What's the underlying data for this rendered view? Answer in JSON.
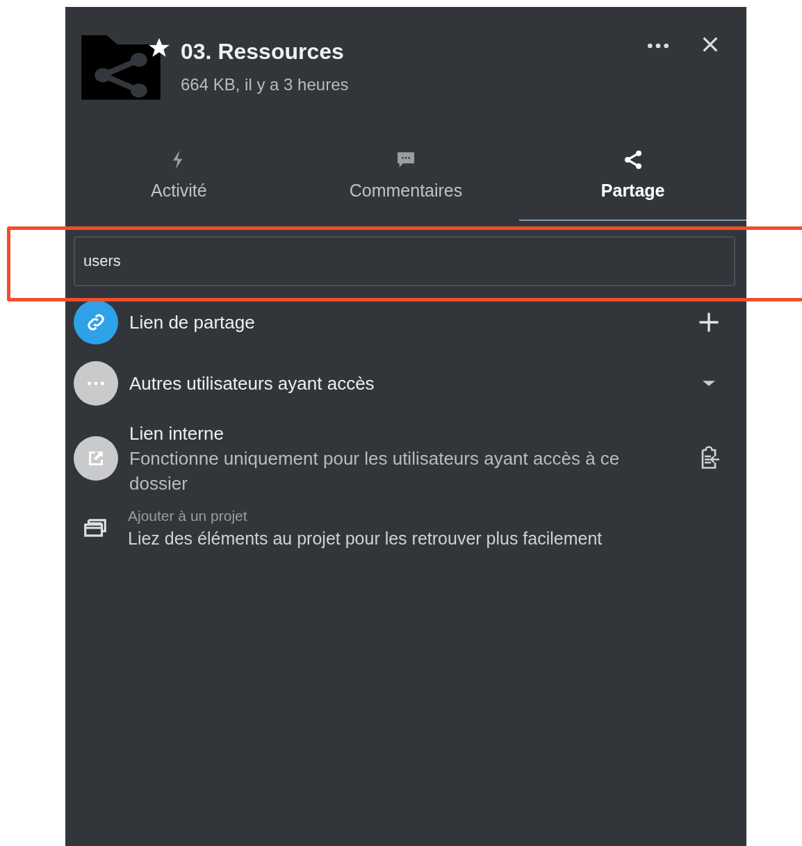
{
  "header": {
    "title": "03. Ressources",
    "subtitle": "664 KB, il y a 3 heures",
    "favorite": true
  },
  "tabs": [
    {
      "label": "Activité",
      "kind": "activity",
      "selected": false
    },
    {
      "label": "Commentaires",
      "kind": "comments",
      "selected": false
    },
    {
      "label": "Partage",
      "kind": "sharing",
      "selected": true
    }
  ],
  "search": {
    "value": "users",
    "highlighted": true
  },
  "entries": [
    {
      "kind": "share-link",
      "title": "Lien de partage",
      "action": {
        "kind": "add"
      }
    },
    {
      "kind": "others",
      "title": "Autres utilisateurs ayant accès",
      "action": {
        "kind": "expand"
      }
    },
    {
      "kind": "internal-link",
      "title": "Lien interne",
      "subtitle": "Fonctionne uniquement pour les utilisateurs ayant accès à ce dossier",
      "action": {
        "kind": "copy"
      }
    }
  ],
  "project": {
    "label": "Ajouter à un projet",
    "description": "Liez des éléments au projet pour les retrouver plus facilement"
  }
}
